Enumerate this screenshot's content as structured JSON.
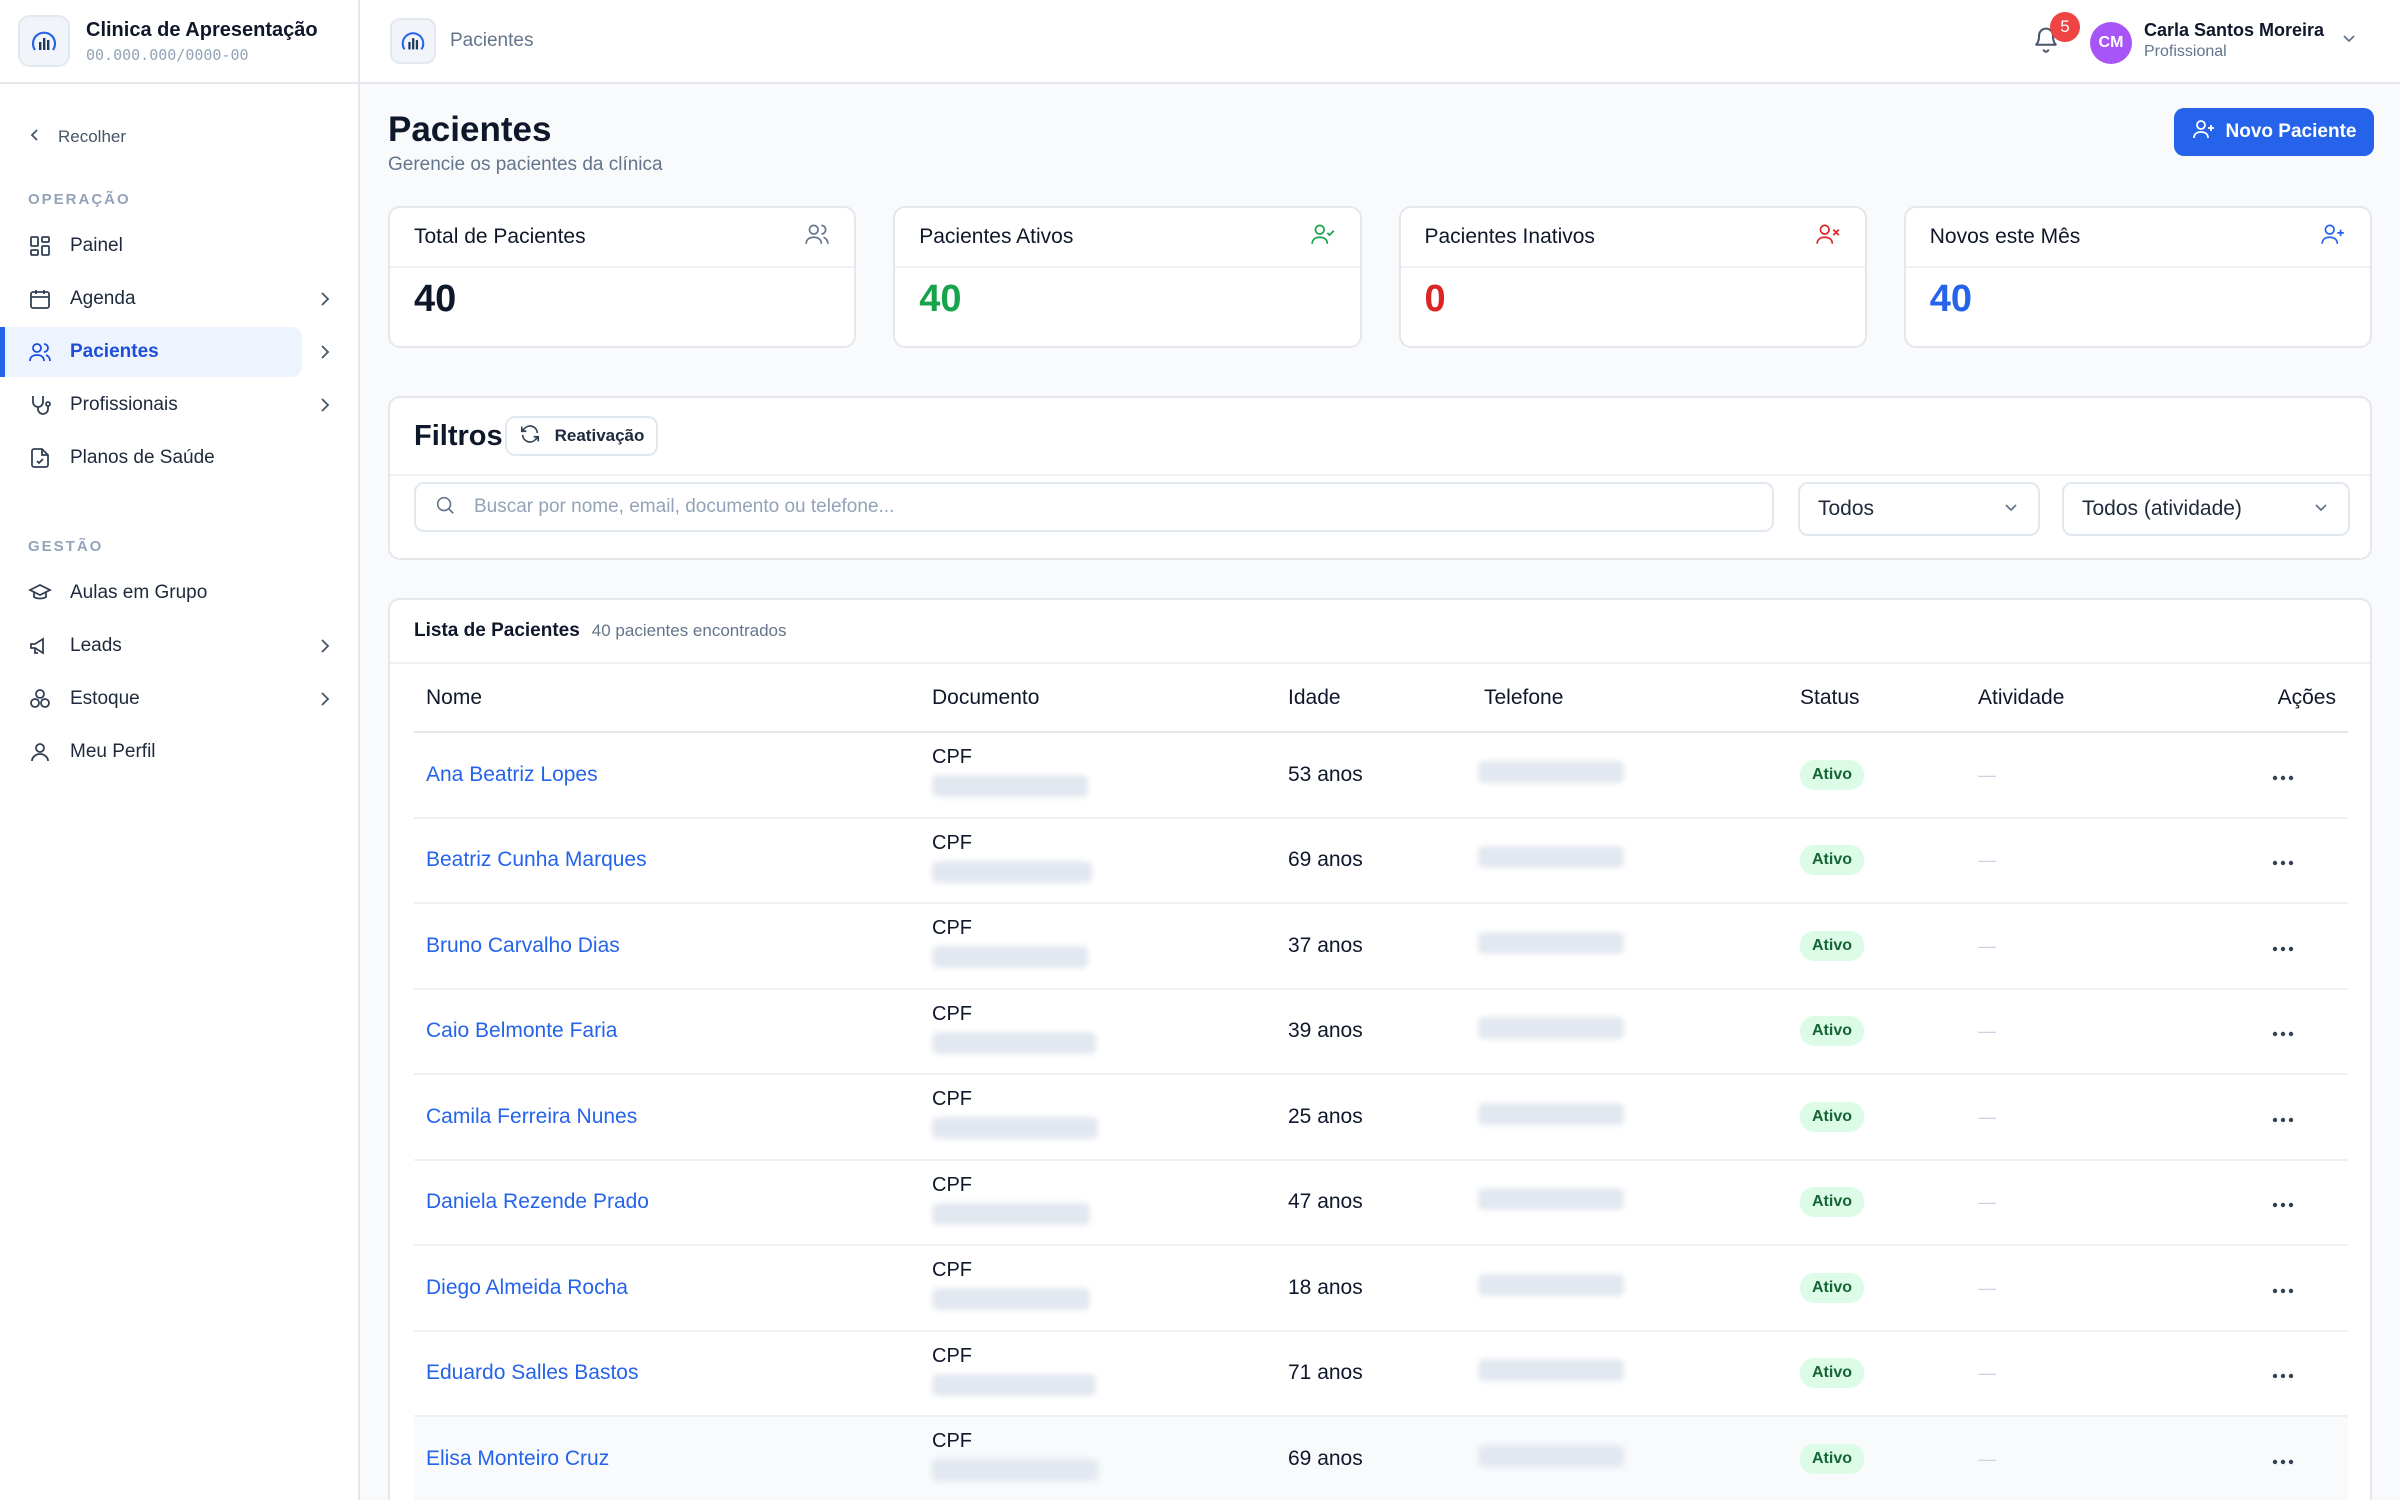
{
  "clinic": {
    "name": "Clinica de Apresentação",
    "document": "00.000.000/0000-00"
  },
  "sidebar": {
    "collapse_label": "Recolher",
    "sections": [
      {
        "label": "OPERAÇÃO",
        "items": [
          {
            "label": "Painel",
            "icon": "grid-icon",
            "chevron": false,
            "active": false
          },
          {
            "label": "Agenda",
            "icon": "calendar-icon",
            "chevron": true,
            "active": false
          },
          {
            "label": "Pacientes",
            "icon": "users-icon",
            "chevron": true,
            "active": true
          },
          {
            "label": "Profissionais",
            "icon": "stethoscope-icon",
            "chevron": true,
            "active": false
          },
          {
            "label": "Planos de Saúde",
            "icon": "file-check-icon",
            "chevron": false,
            "active": false
          }
        ]
      },
      {
        "label": "GESTÃO",
        "items": [
          {
            "label": "Aulas em Grupo",
            "icon": "graduation-cap-icon",
            "chevron": false,
            "active": false
          },
          {
            "label": "Leads",
            "icon": "megaphone-icon",
            "chevron": true,
            "active": false
          },
          {
            "label": "Estoque",
            "icon": "boxes-icon",
            "chevron": true,
            "active": false
          },
          {
            "label": "Meu Perfil",
            "icon": "user-icon",
            "chevron": false,
            "active": false
          }
        ]
      }
    ]
  },
  "topbar": {
    "breadcrumb": "Pacientes",
    "notifications_count": "5",
    "user": {
      "initials": "CM",
      "name": "Carla Santos Moreira",
      "role": "Profissional"
    }
  },
  "page": {
    "title": "Pacientes",
    "subtitle": "Gerencie os pacientes da clínica",
    "new_button": "Novo Paciente"
  },
  "stats": [
    {
      "label": "Total de Pacientes",
      "value": "40",
      "color": "#0f172a",
      "icon": "users-icon",
      "icon_color": "#64748b"
    },
    {
      "label": "Pacientes Ativos",
      "value": "40",
      "color": "#16a34a",
      "icon": "user-check-icon",
      "icon_color": "#16a34a"
    },
    {
      "label": "Pacientes Inativos",
      "value": "0",
      "color": "#dc2626",
      "icon": "user-x-icon",
      "icon_color": "#dc2626"
    },
    {
      "label": "Novos este Mês",
      "value": "40",
      "color": "#2563eb",
      "icon": "user-plus-icon",
      "icon_color": "#2563eb"
    }
  ],
  "filters": {
    "title": "Filtros",
    "reactivation_label": "Reativação",
    "search_placeholder": "Buscar por nome, email, documento ou telefone...",
    "status_select": "Todos",
    "activity_select": "Todos (atividade)"
  },
  "list": {
    "title": "Lista de Pacientes",
    "count": "40 pacientes encontrados",
    "columns": [
      "Nome",
      "Documento",
      "Idade",
      "Telefone",
      "Status",
      "Atividade",
      "Ações"
    ],
    "rows": [
      {
        "name": "Ana Beatriz Lopes",
        "doc_type": "CPF",
        "age": "53 anos",
        "status": "Ativo",
        "activity": "—"
      },
      {
        "name": "Beatriz Cunha Marques",
        "doc_type": "CPF",
        "age": "69 anos",
        "status": "Ativo",
        "activity": "—"
      },
      {
        "name": "Bruno Carvalho Dias",
        "doc_type": "CPF",
        "age": "37 anos",
        "status": "Ativo",
        "activity": "—"
      },
      {
        "name": "Caio Belmonte Faria",
        "doc_type": "CPF",
        "age": "39 anos",
        "status": "Ativo",
        "activity": "—"
      },
      {
        "name": "Camila Ferreira Nunes",
        "doc_type": "CPF",
        "age": "25 anos",
        "status": "Ativo",
        "activity": "—"
      },
      {
        "name": "Daniela Rezende Prado",
        "doc_type": "CPF",
        "age": "47 anos",
        "status": "Ativo",
        "activity": "—"
      },
      {
        "name": "Diego Almeida Rocha",
        "doc_type": "CPF",
        "age": "18 anos",
        "status": "Ativo",
        "activity": "—"
      },
      {
        "name": "Eduardo Salles Bastos",
        "doc_type": "CPF",
        "age": "71 anos",
        "status": "Ativo",
        "activity": "—"
      },
      {
        "name": "Elisa Monteiro Cruz",
        "doc_type": "CPF",
        "age": "69 anos",
        "status": "Ativo",
        "activity": "—"
      }
    ]
  }
}
